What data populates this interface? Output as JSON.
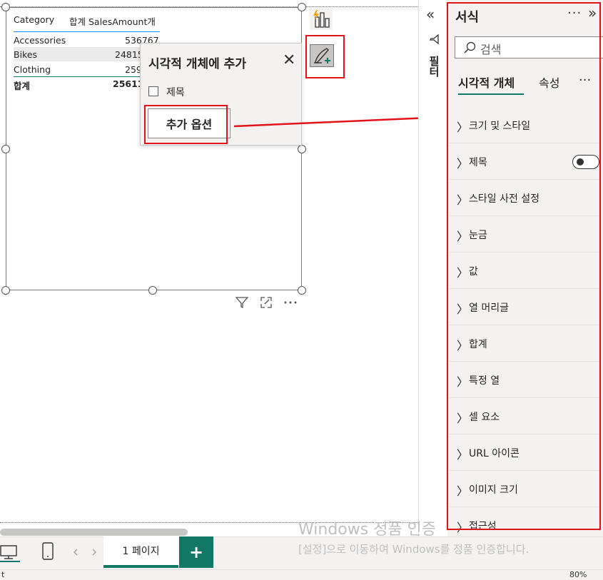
{
  "table": {
    "headers": [
      "Category",
      "합계 SalesAmount개"
    ],
    "rows": [
      {
        "category": "Accessories",
        "value": "536767"
      },
      {
        "category": "Bikes",
        "value": "24815"
      },
      {
        "category": "Clothing",
        "value": "259"
      }
    ],
    "total": {
      "label": "합계",
      "value": "25611"
    }
  },
  "popup": {
    "title": "시각적 개체에 추가",
    "close_glyph": "✕",
    "checkbox_label": "제목",
    "button_label": "추가 옵션"
  },
  "filters_pane": {
    "collapse_glyph": "«",
    "label": "필터"
  },
  "format_pane": {
    "title": "서식",
    "more_glyph": "···",
    "expand_glyph": "»",
    "search_placeholder": "검색",
    "tabs": [
      "시각적 개체",
      "속성"
    ],
    "tab_more_glyph": "···",
    "sections": [
      "크기 및 스타일",
      "제목",
      "스타일 사전 설정",
      "눈금",
      "값",
      "열 머리글",
      "합계",
      "특정 열",
      "셀 요소",
      "URL 아이콘",
      "이미지 크기",
      "접근성"
    ]
  },
  "bottom": {
    "page_tab": "1 페이지",
    "add_page": "+"
  },
  "watermark": {
    "line1": "Windows 정품 인증",
    "line2": "[설정]으로 이동하여 Windows를 정품 인증합니다."
  },
  "status": {
    "left": "t",
    "zoom": "80%"
  },
  "colors": {
    "accent": "#117865",
    "highlight": "#e0131b"
  },
  "icons": [
    "build-visual-icon",
    "format-visual-icon",
    "filter-icon",
    "focus-mode-icon",
    "more-options-icon",
    "search-icon",
    "desktop-icon",
    "mobile-icon"
  ]
}
